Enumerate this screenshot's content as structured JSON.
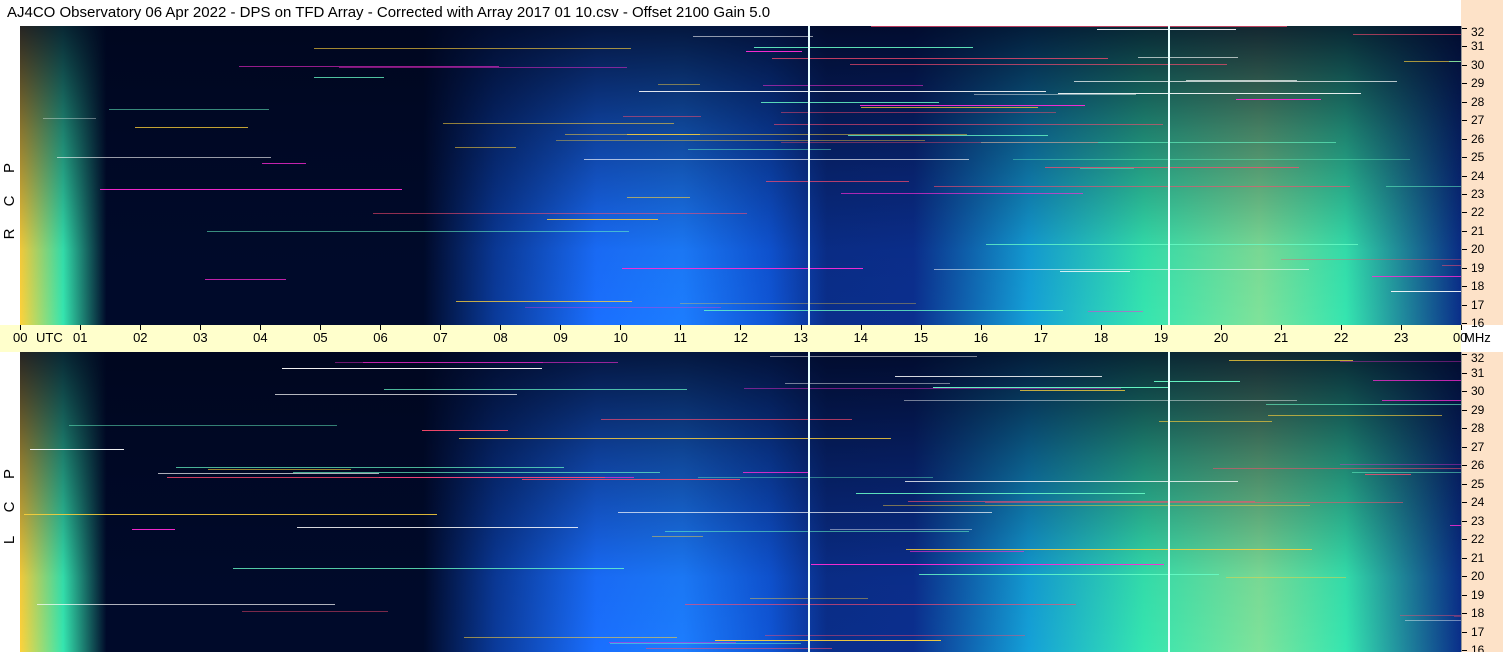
{
  "title": "AJ4CO Observatory  06 Apr 2022  -  DPS on TFD Array  -  Corrected with Array 2017 01 10.csv  -  Offset 2100  Gain 5.0",
  "panels": [
    {
      "id": "rcp",
      "letters": [
        "R",
        "C",
        "P"
      ]
    },
    {
      "id": "lcp",
      "letters": [
        "L",
        "C",
        "P"
      ]
    }
  ],
  "time_axis": {
    "labels": [
      "00",
      "UTC",
      "01",
      "02",
      "03",
      "04",
      "05",
      "06",
      "07",
      "08",
      "09",
      "10",
      "11",
      "12",
      "13",
      "14",
      "15",
      "16",
      "17",
      "18",
      "19",
      "20",
      "21",
      "22",
      "23",
      "00"
    ],
    "unit": "MHz"
  },
  "freq_axis": {
    "labels": [
      "32",
      "31",
      "30",
      "29",
      "28",
      "27",
      "26",
      "25",
      "24",
      "23",
      "22",
      "21",
      "20",
      "19",
      "18",
      "17",
      "16"
    ]
  },
  "colors": {
    "axis_bg": "#fde2c8",
    "time_bar_bg": "#ffffcc",
    "background_low": "#000a2a",
    "band_mid": "#1a6fff",
    "band_high": "#35e6b0",
    "band_peak": "#ffd23a",
    "rfi": "#ff2bd6"
  }
}
